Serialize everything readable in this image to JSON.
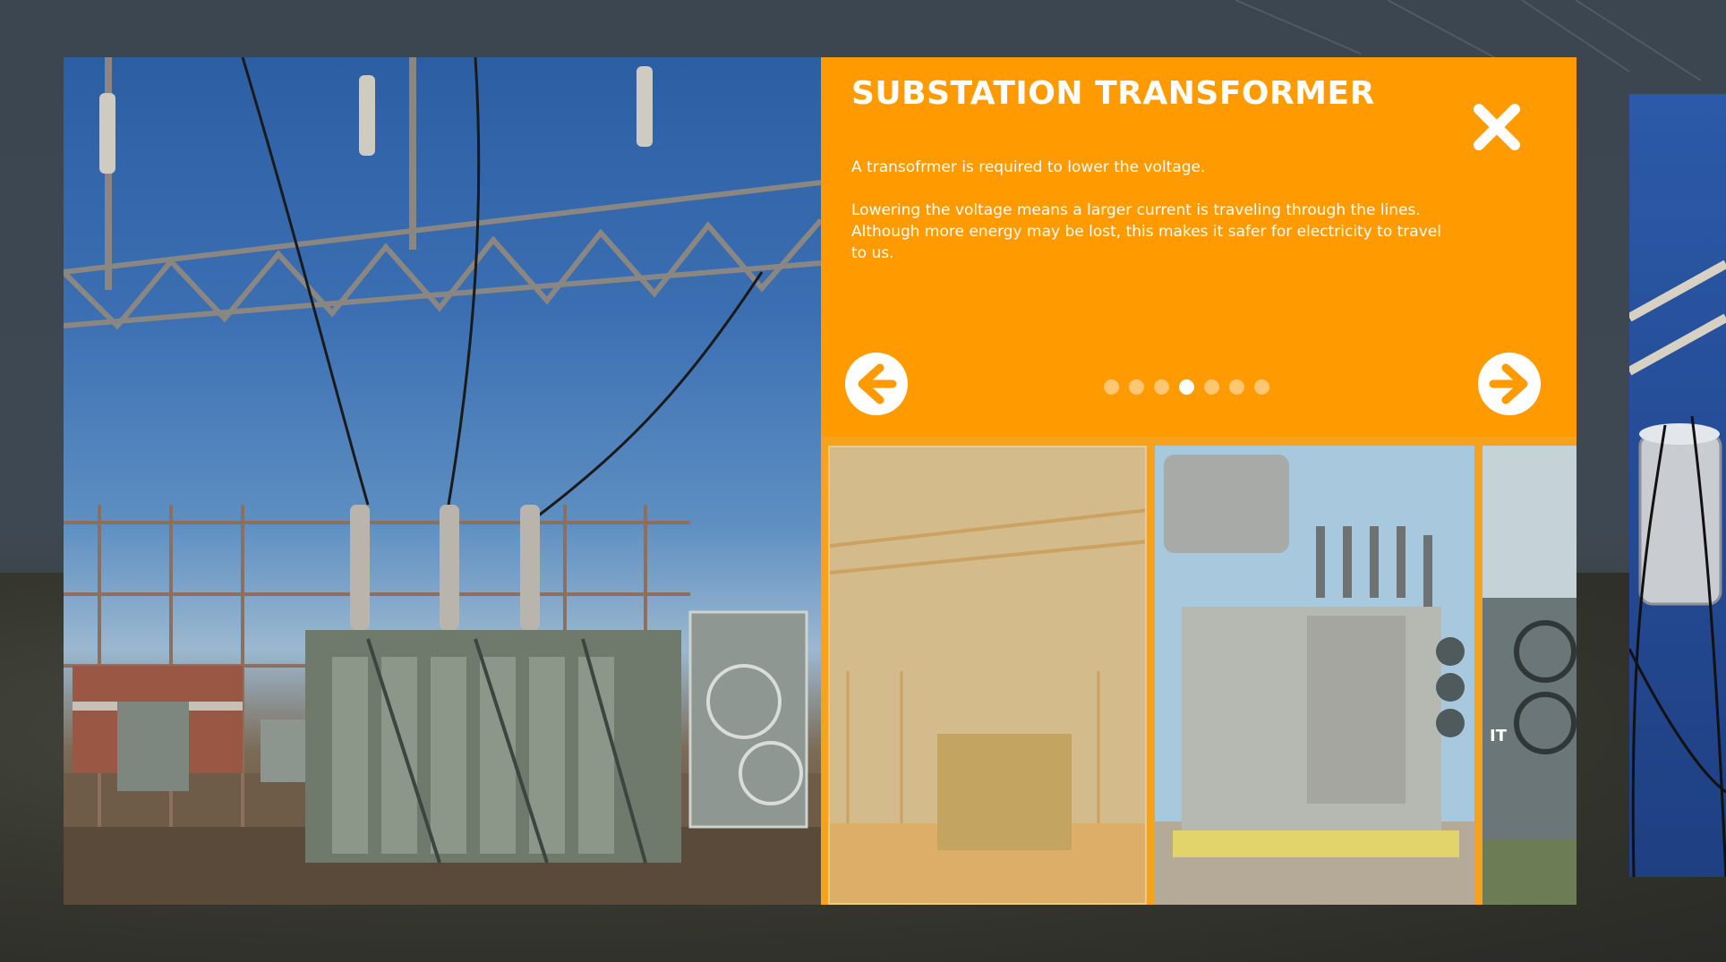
{
  "modal": {
    "title": "SUBSTATION TRANSFORMER",
    "paragraphs": [
      "A transofrmer is required to lower the voltage.",
      "Lowering the voltage means a larger current is traveling through the lines. Although more energy may be lost, this makes it safer for electricity to travel to us."
    ],
    "close_icon": "close-x-icon",
    "prev_icon": "arrow-left-circle-icon",
    "next_icon": "arrow-right-circle-icon",
    "pagination": {
      "total": 7,
      "active_index": 3
    },
    "thumbnails": [
      {
        "label": "substation-transformer-photo",
        "state": "selected"
      },
      {
        "label": "large-power-transformer-photo",
        "state": "normal"
      },
      {
        "label": "transformer-radiators-photo",
        "state": "partial",
        "visible_text": "IT"
      }
    ]
  },
  "colors": {
    "accent": "#ff9a00",
    "panel_bg": "#f7a21c",
    "dot_inactive": "rgba(255,255,255,0.45)",
    "dot_active": "#ffffff"
  }
}
